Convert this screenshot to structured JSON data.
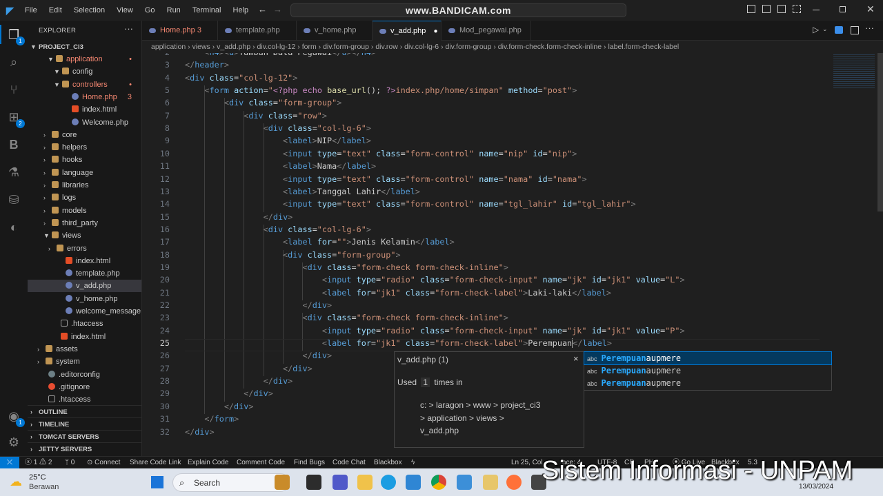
{
  "menu": [
    "File",
    "Edit",
    "Selection",
    "View",
    "Go",
    "Run",
    "Terminal",
    "Help"
  ],
  "search_bar_text": "www.BANDICAM.com",
  "explorer": {
    "header": "EXPLORER",
    "project": "PROJECT_CI3",
    "items": [
      {
        "label": "application",
        "badge": "•"
      },
      {
        "label": "config"
      },
      {
        "label": "controllers",
        "badge": "•"
      },
      {
        "label": "Home.php",
        "badge": "3"
      },
      {
        "label": "index.html"
      },
      {
        "label": "Welcome.php"
      },
      {
        "label": "core"
      },
      {
        "label": "helpers"
      },
      {
        "label": "hooks"
      },
      {
        "label": "language"
      },
      {
        "label": "libraries"
      },
      {
        "label": "logs"
      },
      {
        "label": "models"
      },
      {
        "label": "third_party"
      },
      {
        "label": "views"
      },
      {
        "label": "errors"
      },
      {
        "label": "index.html"
      },
      {
        "label": "template.php"
      },
      {
        "label": "v_add.php"
      },
      {
        "label": "v_home.php"
      },
      {
        "label": "welcome_message...."
      },
      {
        "label": ".htaccess"
      },
      {
        "label": "index.html"
      },
      {
        "label": "assets"
      },
      {
        "label": "system"
      },
      {
        "label": ".editorconfig"
      },
      {
        "label": ".gitignore"
      },
      {
        "label": ".htaccess"
      }
    ],
    "sections": [
      "OUTLINE",
      "TIMELINE",
      "TOMCAT SERVERS",
      "JETTY SERVERS"
    ]
  },
  "tabs": [
    {
      "label": "Home.php",
      "badge": "3"
    },
    {
      "label": "template.php"
    },
    {
      "label": "v_home.php"
    },
    {
      "label": "v_add.php",
      "badge": "●"
    },
    {
      "label": "Mod_pegawai.php"
    }
  ],
  "breadcrumb": [
    "application",
    "views",
    "v_add.php",
    "div.col-lg-12",
    "form",
    "div.form-group",
    "div.row",
    "div.col-lg-6",
    "div.form-group",
    "div.form-check.form-check-inline",
    "label.form-check-label"
  ],
  "line_numbers": [
    "2",
    "3",
    "4",
    "5",
    "6",
    "7",
    "8",
    "9",
    "10",
    "11",
    "12",
    "13",
    "14",
    "15",
    "16",
    "17",
    "18",
    "19",
    "20",
    "21",
    "22",
    "23",
    "24",
    "25",
    "26",
    "27",
    "28",
    "29",
    "30",
    "31",
    "32"
  ],
  "hover": {
    "title": "v_add.php  (1)",
    "used_prefix": "Used",
    "used_count": "1",
    "used_suffix": "times in",
    "path1": "c: > laragon > www > project_ci3",
    "path2": "> application > views >",
    "path3": "v_add.php",
    "close": "×"
  },
  "suggestions": [
    {
      "kind": "abc",
      "match": "Perempuan",
      "rest": "aupmere"
    },
    {
      "kind": "abc",
      "match": "Perempuan",
      "rest": "aupmere"
    },
    {
      "kind": "abc",
      "match": "Perempuan",
      "rest": "aupmere"
    }
  ],
  "status": {
    "errors": "1",
    "warnings": "2",
    "info": "0",
    "items": [
      "Connect",
      "Share Code Link",
      "Explain Code",
      "Comment Code",
      "Find Bugs",
      "Code Chat",
      "Blackbox"
    ],
    "position": "Ln 25, Col",
    "spaces": "ace: 4",
    "encoding": "UTF-8",
    "eol": "CR",
    "lang": "PH",
    "golive": "Go Live",
    "blackbox": "Blackbox",
    "version": "5.3"
  },
  "taskbar": {
    "temp": "25°C",
    "weather": "Berawan",
    "search": "Search",
    "date": "13/03/2024"
  },
  "watermark": "Sistem Informasi - UNPAM"
}
